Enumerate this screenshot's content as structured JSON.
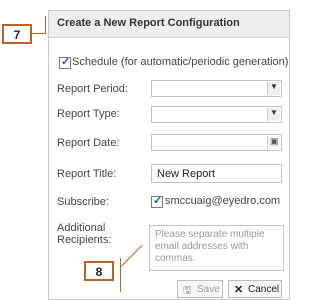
{
  "panel": {
    "title": "Create a New Report Configuration"
  },
  "schedule": {
    "checked": true,
    "label": "Schedule (for automatic/periodic generation)"
  },
  "form": {
    "report_period_label": "Report Period:",
    "report_type_label": "Report Type:",
    "report_date_label": "Report Date:",
    "report_title_label": "Report Title:",
    "report_title_value": "New Report",
    "subscribe_label": "Subscribe:",
    "subscribe_checked": true,
    "subscribe_email": "smccuaig@eyedro.com",
    "additional_label_1": "Additional",
    "additional_label_2": "Recipients:",
    "additional_placeholder": "Please separate multiple email addresses with commas."
  },
  "buttons": {
    "save_label": "Save",
    "cancel_label": "Cancel"
  },
  "callouts": {
    "top": "7",
    "bottom": "8"
  },
  "icons": {
    "dropdown": "chevron-down-icon",
    "calendar": "calendar-icon",
    "save": "floppy-disk-icon",
    "cancel": "x-icon"
  },
  "colors": {
    "callout_border": "#b5652c",
    "header_bg": "#eeeeee"
  }
}
